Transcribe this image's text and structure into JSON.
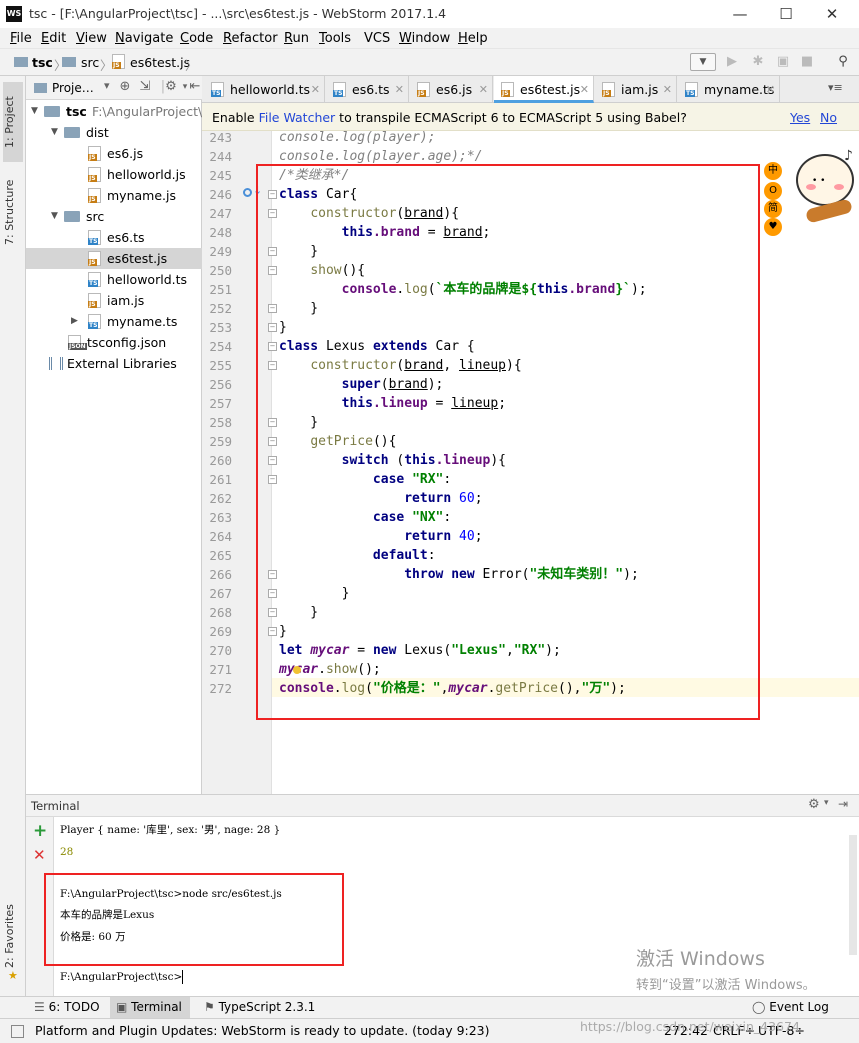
{
  "window": {
    "title": "tsc - [F:\\AngularProject\\tsc] - ...\\src\\es6test.js - WebStorm 2017.1.4",
    "logo": "WS",
    "minimize": "—",
    "maximize": "☐",
    "close": "✕"
  },
  "menu": [
    {
      "u": "F",
      "rest": "ile"
    },
    {
      "u": "E",
      "rest": "dit"
    },
    {
      "u": "V",
      "rest": "iew"
    },
    {
      "u": "N",
      "rest": "avigate"
    },
    {
      "u": "C",
      "rest": "ode"
    },
    {
      "u": "R",
      "rest": "efactor"
    },
    {
      "u": "R",
      "rest": "un"
    },
    {
      "u": "T",
      "rest": "ools"
    },
    {
      "u": "",
      "rest": "VCS"
    },
    {
      "u": "W",
      "rest": "indow"
    },
    {
      "u": "H",
      "rest": "elp"
    }
  ],
  "breadcrumb": {
    "root": "tsc",
    "folder": "src",
    "file": "es6test.js"
  },
  "side_tabs": {
    "project": "1: Project",
    "structure": "7: Structure",
    "favorites": "2: Favorites"
  },
  "project": {
    "head_label": "Proje…",
    "root_name": "tsc",
    "root_path": "F:\\AngularProject\\t",
    "tree": [
      {
        "name": "dist"
      },
      {
        "name": "es6.js"
      },
      {
        "name": "helloworld.js"
      },
      {
        "name": "myname.js"
      },
      {
        "name": "src"
      },
      {
        "name": "es6.ts"
      },
      {
        "name": "es6test.js"
      },
      {
        "name": "helloworld.ts"
      },
      {
        "name": "iam.js"
      },
      {
        "name": "myname.ts"
      },
      {
        "name": "tsconfig.json"
      },
      {
        "name": "External Libraries"
      }
    ]
  },
  "tabs": [
    "helloworld.ts",
    "es6.ts",
    "es6.js",
    "es6test.js",
    "iam.js",
    "myname.ts"
  ],
  "tab_overflow": "▾≡",
  "banner": {
    "pre": "Enable ",
    "link": "File Watcher",
    "post": " to transpile ECMAScript 6 to ECMAScript 5 using Babel?",
    "yes": "Yes",
    "no": "No"
  },
  "editor": {
    "line_numbers": [
      "243",
      "244",
      "245",
      "246",
      "247",
      "248",
      "249",
      "250",
      "251",
      "252",
      "253",
      "254",
      "255",
      "256",
      "257",
      "258",
      "259",
      "260",
      "261",
      "262",
      "263",
      "264",
      "265",
      "266",
      "267",
      "268",
      "269",
      "270",
      "271",
      "272"
    ],
    "strings": {
      "c243": "console.log(player);",
      "c244": "console.log(player.age);*/",
      "c245": "/*类继承*/",
      "class": "class",
      "Car": " Car{",
      "constructor": "constructor",
      "brand": "brand",
      "this": "this",
      "dotbrand": ".brand",
      "show": "show",
      "console": "console",
      "log": "log",
      "tpl1": "`本车的品牌是${",
      "tpl2": "}`",
      "Lexus": " Lexus ",
      "extends": "extends",
      "CarBrace": " Car {",
      "lineup": "lineup",
      "super": "super",
      "dotlineup": ".lineup",
      "getPrice": "getPrice",
      "switch": "switch",
      "case": "case",
      "RX": "\"RX\"",
      "NX": "\"NX\"",
      "return": "return",
      "n60": "60",
      "n40": "40",
      "default": "default",
      "throw": "throw",
      "new": "new",
      "Error": " Error(",
      "errmsg": "\"未知车类别！\"",
      "let": "let",
      "mycar": "mycar",
      "LexusCall": " Lexus(",
      "sLexus": "\"Lexus\"",
      "sRX": "\"RX\"",
      "price": "\"价格是：\"",
      "wan": "\"万\"",
      "my": "my",
      "car": "car"
    }
  },
  "terminal": {
    "title": "Terminal",
    "line1": "Player { name: '库里', sex: '男', nage: 28 }",
    "line2": "28",
    "cmd": "F:\\AngularProject\\tsc>node src/es6test.js",
    "out1": "本车的品牌是Lexus",
    "out2": "价格是:  60 万",
    "prompt": "F:\\AngularProject\\tsc>"
  },
  "toolwindows": {
    "todo": "6: TODO",
    "terminal": "Terminal",
    "typescript": "TypeScript 2.3.1",
    "eventlog": "Event Log"
  },
  "status": {
    "message": "Platform and Plugin Updates: WebStorm is ready to update. (today 9:23)",
    "position": "272:42",
    "line_sep": "CRLF÷",
    "encoding": "UTF-8÷"
  },
  "watermark": {
    "line1": "激活 Windows",
    "line2": "转到“设置”以激活 Windows。"
  },
  "csdn": "https://blog.csdn.net/weixin_43674"
}
